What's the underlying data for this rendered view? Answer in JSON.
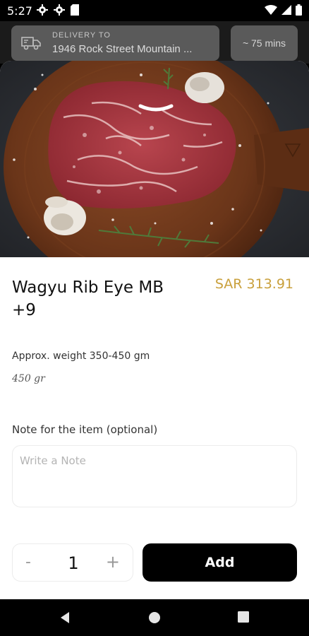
{
  "status_bar": {
    "time": "5:27",
    "left_icons": [
      "gear-icon",
      "gear-icon",
      "sd-card-icon"
    ],
    "right_icons": [
      "wifi-icon",
      "signal-icon",
      "battery-icon"
    ]
  },
  "delivery": {
    "label": "DELIVERY TO",
    "address": "1946 Rock Street Mountain ...",
    "eta": "~ 75 mins"
  },
  "product": {
    "name": "Wagyu Rib Eye MB +9",
    "price": "SAR 313.91",
    "approx_weight": "Approx. weight 350-450 gm",
    "weight": "450 gr"
  },
  "note": {
    "label": "Note for the item (optional)",
    "placeholder": "Write a Note",
    "value": ""
  },
  "quantity": {
    "minus": "-",
    "value": "1",
    "plus": "+"
  },
  "actions": {
    "add_label": "Add"
  },
  "colors": {
    "price": "#c9a03c",
    "button": "#000000"
  }
}
